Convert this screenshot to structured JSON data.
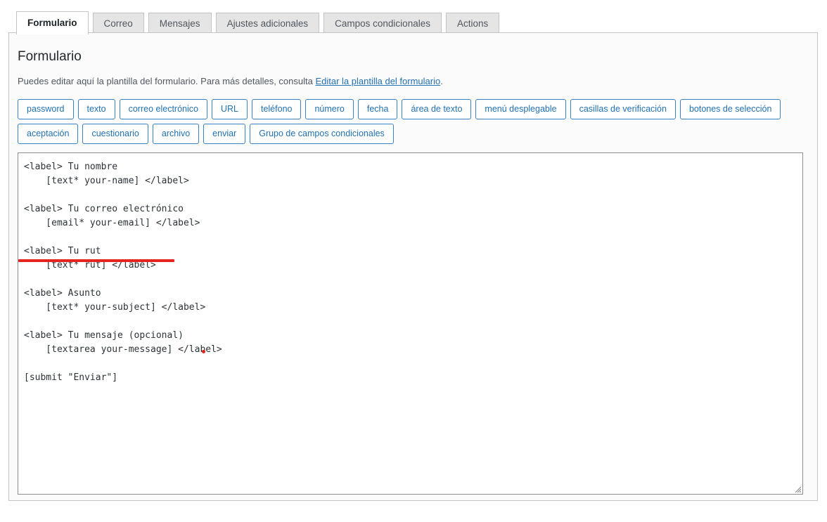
{
  "tabs": [
    {
      "label": "Formulario",
      "active": true
    },
    {
      "label": "Correo",
      "active": false
    },
    {
      "label": "Mensajes",
      "active": false
    },
    {
      "label": "Ajustes adicionales",
      "active": false
    },
    {
      "label": "Campos condicionales",
      "active": false
    },
    {
      "label": "Actions",
      "active": false
    }
  ],
  "panel": {
    "title": "Formulario",
    "description_before_link": "Puedes editar aquí la plantilla del formulario. Para más detalles, consulta ",
    "description_link": "Editar la plantilla del formulario",
    "description_after_link": "."
  },
  "tag_buttons": [
    {
      "label": "password"
    },
    {
      "label": "texto"
    },
    {
      "label": "correo electrónico"
    },
    {
      "label": "URL"
    },
    {
      "label": "teléfono"
    },
    {
      "label": "número"
    },
    {
      "label": "fecha"
    },
    {
      "label": "área de texto"
    },
    {
      "label": "menú desplegable"
    },
    {
      "label": "casillas de verificación"
    },
    {
      "label": "botones de selección"
    },
    {
      "label": "aceptación"
    },
    {
      "label": "cuestionario"
    },
    {
      "label": "archivo"
    },
    {
      "label": "enviar"
    },
    {
      "label": "Grupo de campos condicionales"
    }
  ],
  "editor": {
    "value": "<label> Tu nombre\n    [text* your-name] </label>\n\n<label> Tu correo electrónico\n    [email* your-email] </label>\n\n<label> Tu rut\n    [text* rut] </label>\n\n<label> Asunto\n    [text* your-subject] </label>\n\n<label> Tu mensaje (opcional)\n    [textarea your-message] </label>\n\n[submit \"Enviar\"]",
    "placeholder": ""
  },
  "annotations": {
    "underline_color": "#e52420",
    "dot_color": "#e52420",
    "underline_target_text": "[text* rut] </label>",
    "dot_target_text": "[textarea your-message] </label>"
  },
  "colors": {
    "accent_blue": "#2271b1",
    "tag_border": "#3582c4",
    "tab_inactive_bg": "#e5e5e5",
    "panel_border": "#c3c4c7",
    "annotation_red": "#e52420"
  }
}
